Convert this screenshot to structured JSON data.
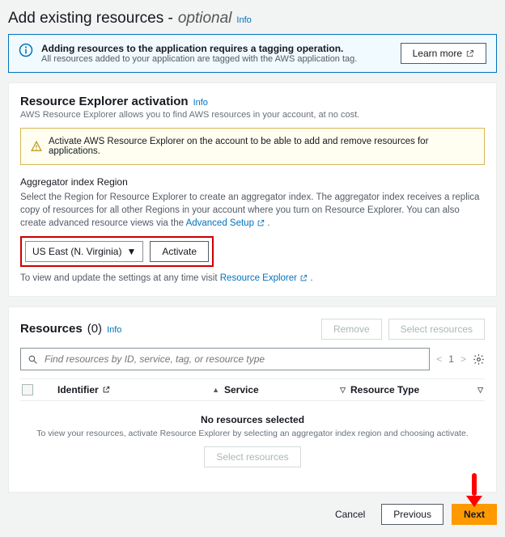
{
  "header": {
    "title": "Add existing resources -",
    "optional": "optional",
    "info": "Info"
  },
  "alert": {
    "title": "Adding resources to the application requires a tagging operation.",
    "sub": "All resources added to your application are tagged with the AWS application tag.",
    "learn_more": "Learn more"
  },
  "activation": {
    "title": "Resource Explorer activation",
    "info": "Info",
    "sub": "AWS Resource Explorer allows you to find AWS resources in your account, at no cost.",
    "warn": "Activate AWS Resource Explorer on the account to be able to add and remove resources for applications.",
    "agg_label": "Aggregator index Region",
    "agg_desc": "Select the Region for Resource Explorer to create an aggregator index. The aggregator index receives a replica copy of resources for all other Regions in your account where you turn on Resource Explorer. You can also create advanced resource views via the ",
    "advanced_setup": "Advanced Setup",
    "region_selected": "US East (N. Virginia)",
    "activate_btn": "Activate",
    "visit_prefix": "To view and update the settings at any time visit ",
    "visit_link": "Resource Explorer"
  },
  "resources": {
    "title": "Resources",
    "count": "(0)",
    "info": "Info",
    "remove_btn": "Remove",
    "select_btn": "Select resources",
    "search_placeholder": "Find resources by ID, service, tag, or resource type",
    "page": "1",
    "cols": {
      "identifier": "Identifier",
      "service": "Service",
      "rtype": "Resource Type"
    },
    "empty_title": "No resources selected",
    "empty_desc": "To view your resources, activate Resource Explorer by selecting an aggregator index region and choosing activate.",
    "empty_btn": "Select resources"
  },
  "footer": {
    "cancel": "Cancel",
    "previous": "Previous",
    "next": "Next"
  }
}
